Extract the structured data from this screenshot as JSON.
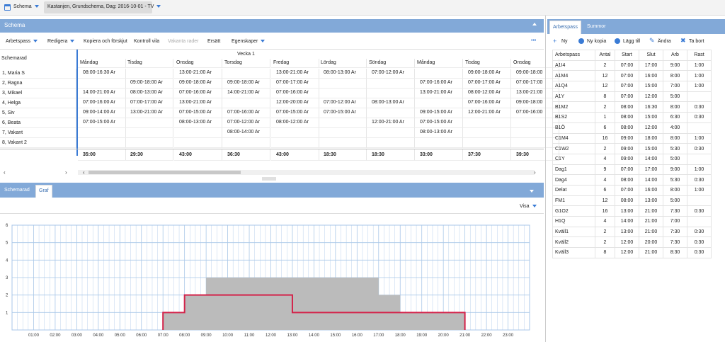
{
  "topbar": {
    "schema_label": "Schema",
    "selector": "Kastanjen, Grundschema, Dag: 2016-10-01 - TV"
  },
  "schema_panel": {
    "title": "Schema"
  },
  "toolbar": {
    "arbetspass": "Arbetspass",
    "redigera": "Redigera",
    "kopiera": "Kopiera och förskjut",
    "kontroll": "Kontroll vila",
    "vakanta": "Vakanta rader",
    "ersatt": "Ersätt",
    "egenskaper": "Egenskaper",
    "more": "•••"
  },
  "grid": {
    "row_header": "Schemarad",
    "week": "Vecka 1",
    "days": [
      "Måndag",
      "Tisdag",
      "Onsdag",
      "Torsdag",
      "Fredag",
      "Lördag",
      "Söndag",
      "Måndag",
      "Tisdag",
      "Onsdag"
    ],
    "rows": [
      {
        "name": "1, Maria S",
        "cells": [
          "08:00-16:30  Ar",
          "",
          "13:00-21:00  Ar",
          "",
          "13:00-21:00  Ar",
          "08:00-13:00  Ar",
          "07:00-12:00  Ar",
          "",
          "09:00-18:00  Ar",
          "09:00-18:00"
        ]
      },
      {
        "name": "2, Ragna",
        "cells": [
          "",
          "09:00-18:00  Ar",
          "09:00-18:00  Ar",
          "09:00-18:00  Ar",
          "07:00-17:00  Ar",
          "",
          "",
          "07:00-16:00  Ar",
          "07:00-17:00  Ar",
          "07:00-17:00"
        ]
      },
      {
        "name": "3, Mikael",
        "cells": [
          "14:00-21:00  Ar",
          "08:00-13:00  Ar",
          "07:00-16:00  Ar",
          "14:00-21:00  Ar",
          "07:00-16:00  Ar",
          "",
          "",
          "13:00-21:00  Ar",
          "08:00-12:00  Ar",
          "13:00-21:00"
        ]
      },
      {
        "name": "4, Helga",
        "cells": [
          "07:00-16:00  Ar",
          "07:00-17:00  Ar",
          "13:00-21:00  Ar",
          "",
          "12:00-20:00  Ar",
          "07:00-12:00  Ar",
          "08:00-13:00  Ar",
          "",
          "07:00-16:00  Ar",
          "09:00-18:00"
        ]
      },
      {
        "name": "5, Siv",
        "cells": [
          "09:00-14:00  Ar",
          "13:00-21:00  Ar",
          "07:00-15:00  Ar",
          "07:00-16:00  Ar",
          "07:00-15:00  Ar",
          "07:00-15:00  Ar",
          "",
          "09:00-15:00  Ar",
          "12:00-21:00  Ar",
          "07:00-16:00"
        ]
      },
      {
        "name": "6, Beata",
        "cells": [
          "07:00-15:00  Ar",
          "",
          "08:00-13:00  Ar",
          "07:00-12:00  Ar",
          "08:00-12:00  Ar",
          "",
          "12:00-21:00  Ar",
          "07:00-15:00  Ar",
          "",
          ""
        ]
      },
      {
        "name": "7, Vakant",
        "cells": [
          "",
          "",
          "",
          "08:00-14:00  Ar",
          "",
          "",
          "",
          "08:00-13:00  Ar",
          "",
          ""
        ]
      },
      {
        "name": "8, Vakant 2",
        "cells": [
          "",
          "",
          "",
          "",
          "",
          "",
          "",
          "",
          "",
          ""
        ]
      }
    ],
    "totals": [
      "35:00",
      "29:30",
      "43:00",
      "36:30",
      "43:00",
      "18:30",
      "18:30",
      "33:00",
      "37:30",
      "39:30"
    ]
  },
  "bottom": {
    "tab1": "Schemarad",
    "tab2": "Graf",
    "visa": "Visa"
  },
  "right": {
    "tab1": "Arbetspass",
    "tab2": "Summor",
    "actions": {
      "ny": "Ny",
      "kopia": "Ny kopia",
      "lagg": "Lägg till",
      "andra": "Ändra",
      "tabort": "Ta bort"
    },
    "cols": [
      "Arbetspass",
      "Antal",
      "Start",
      "Slut",
      "Arb",
      "Rast"
    ],
    "rows": [
      [
        "A1I4",
        "2",
        "07:00",
        "17:00",
        "9:00",
        "1:00"
      ],
      [
        "A1M4",
        "12",
        "07:00",
        "16:00",
        "8:00",
        "1:00"
      ],
      [
        "A1Q4",
        "12",
        "07:00",
        "15:00",
        "7:00",
        "1:00"
      ],
      [
        "A1Y",
        "8",
        "07:00",
        "12:00",
        "5:00",
        ""
      ],
      [
        "B1M2",
        "2",
        "08:00",
        "16:30",
        "8:00",
        "0:30"
      ],
      [
        "B1S2",
        "1",
        "08:00",
        "15:00",
        "6:30",
        "0:30"
      ],
      [
        "B1Ö",
        "6",
        "08:00",
        "12:00",
        "4:00",
        ""
      ],
      [
        "C1M4",
        "16",
        "09:00",
        "18:00",
        "8:00",
        "1:00"
      ],
      [
        "C1W2",
        "2",
        "09:00",
        "15:00",
        "5:30",
        "0:30"
      ],
      [
        "C1Y",
        "4",
        "09:00",
        "14:00",
        "5:00",
        ""
      ],
      [
        "Dag1",
        "9",
        "07:00",
        "17:00",
        "9:00",
        "1:00"
      ],
      [
        "Dag4",
        "4",
        "08:00",
        "14:00",
        "5:30",
        "0:30"
      ],
      [
        "Delat",
        "6",
        "07:00",
        "16:00",
        "8:00",
        "1:00"
      ],
      [
        "FM1",
        "12",
        "08:00",
        "13:00",
        "5:00",
        ""
      ],
      [
        "G1O2",
        "16",
        "13:00",
        "21:00",
        "7:30",
        "0:30"
      ],
      [
        "H1Q",
        "4",
        "14:00",
        "21:00",
        "7:00",
        ""
      ],
      [
        "Kväll1",
        "2",
        "13:00",
        "21:00",
        "7:30",
        "0:30"
      ],
      [
        "Kväll2",
        "2",
        "12:00",
        "20:00",
        "7:30",
        "0:30"
      ],
      [
        "Kväll3",
        "8",
        "12:00",
        "21:00",
        "8:30",
        "0:30"
      ]
    ]
  },
  "chart_data": {
    "type": "area",
    "y_ticks": [
      "1",
      "2",
      "3",
      "4",
      "5",
      "6"
    ],
    "ylim": [
      0,
      6
    ],
    "x_ticks": [
      "01:00",
      "02:00",
      "03:00",
      "04:00",
      "05:00",
      "06:00",
      "07:00",
      "08:00",
      "09:00",
      "10:00",
      "11:00",
      "12:00",
      "13:00",
      "14:00",
      "15:00",
      "16:00",
      "17:00",
      "18:00",
      "19:00",
      "20:00",
      "21:00",
      "22:00",
      "23:00"
    ],
    "xlim": [
      0,
      24
    ],
    "area_steps": [
      [
        7,
        1
      ],
      [
        8,
        2
      ],
      [
        9,
        3
      ],
      [
        17,
        2
      ],
      [
        18,
        1
      ],
      [
        21,
        0
      ]
    ],
    "line_steps": [
      [
        7,
        1
      ],
      [
        8,
        2
      ],
      [
        13,
        1
      ],
      [
        21,
        0
      ]
    ],
    "colors": {
      "area": "#bbbbbb",
      "line": "#d3234a",
      "grid": "#a9c7e8"
    }
  }
}
